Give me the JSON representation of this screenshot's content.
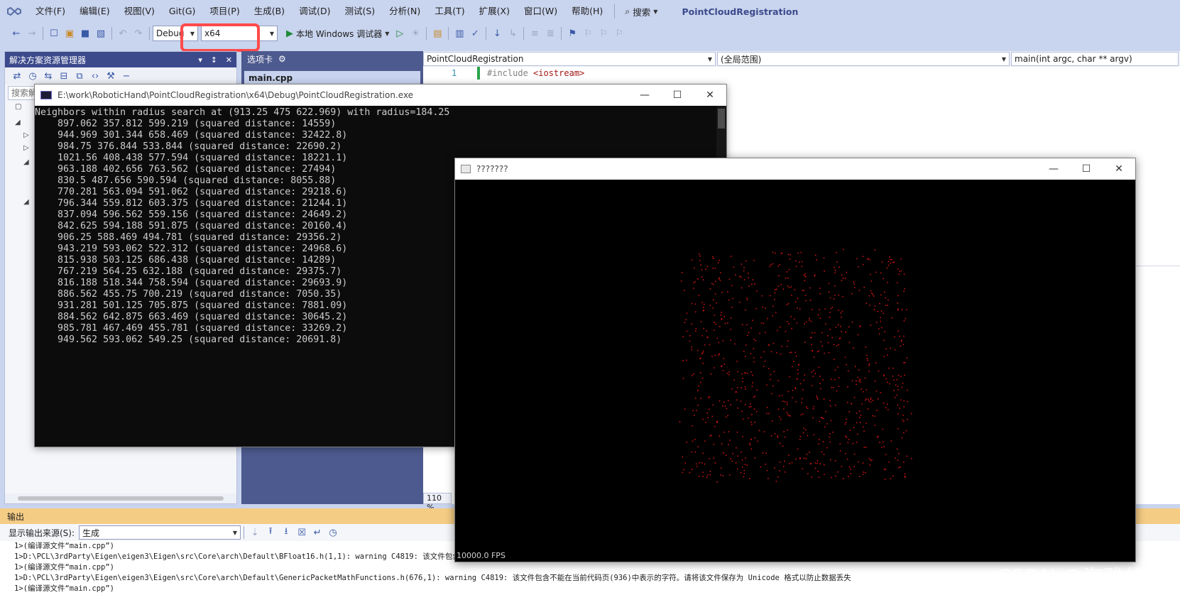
{
  "menubar": {
    "items": [
      "文件(F)",
      "编辑(E)",
      "视图(V)",
      "Git(G)",
      "项目(P)",
      "生成(B)",
      "调试(D)",
      "测试(S)",
      "分析(N)",
      "工具(T)",
      "扩展(X)",
      "窗口(W)",
      "帮助(H)"
    ],
    "search_label": "搜索",
    "solution_title": "PointCloudRegistration"
  },
  "toolbar": {
    "config": "Debug",
    "platform": "x64",
    "run_label": "本地 Windows 调试器"
  },
  "solution_explorer": {
    "title": "解决方案资源管理器",
    "search_placeholder": "搜索解"
  },
  "editor": {
    "tabwell_title": "选项卡",
    "active_tab": "main.cpp",
    "nav": {
      "project": "PointCloudRegistration",
      "scope": "(全局范围)",
      "member": "main(int argc, char ** argv)"
    },
    "line_number": "1",
    "code_prefix": "#include ",
    "code_include": "<iostream>",
    "zoom": "110 %"
  },
  "console": {
    "title": "E:\\work\\RoboticHand\\PointCloudRegistration\\x64\\Debug\\PointCloudRegistration.exe",
    "lines": [
      "Neighbors within radius search at (913.25 475 622.969) with radius=184.25",
      "    897.062 357.812 599.219 (squared distance: 14559)",
      "    944.969 301.344 658.469 (squared distance: 32422.8)",
      "    984.75 376.844 533.844 (squared distance: 22690.2)",
      "    1021.56 408.438 577.594 (squared distance: 18221.1)",
      "    963.188 402.656 763.562 (squared distance: 27494)",
      "    830.5 487.656 590.594 (squared distance: 8055.88)",
      "    770.281 563.094 591.062 (squared distance: 29218.6)",
      "    796.344 559.812 603.375 (squared distance: 21244.1)",
      "    837.094 596.562 559.156 (squared distance: 24649.2)",
      "    842.625 594.188 591.875 (squared distance: 20160.4)",
      "    906.25 588.469 494.781 (squared distance: 29356.2)",
      "    943.219 593.062 522.312 (squared distance: 24968.6)",
      "    815.938 503.125 686.438 (squared distance: 14289)",
      "    767.219 564.25 632.188 (squared distance: 29375.7)",
      "    816.188 518.344 758.594 (squared distance: 29693.9)",
      "    886.562 455.75 700.219 (squared distance: 7050.35)",
      "    931.281 501.125 705.875 (squared distance: 7881.09)",
      "    884.562 642.875 663.469 (squared distance: 30645.2)",
      "    985.781 467.469 455.781 (squared distance: 33269.2)",
      "    949.562 593.062 549.25 (squared distance: 20691.8)"
    ]
  },
  "viewer": {
    "title": "???????",
    "fps": "10000.0 FPS",
    "point_color": "#c81414",
    "point_count": 900
  },
  "output": {
    "title": "输出",
    "source_label": "显示输出来源(S):",
    "source_value": "生成",
    "lines": [
      "1>(编译源文件“main.cpp”)",
      "1>D:\\PCL\\3rdParty\\Eigen\\eigen3\\Eigen\\src\\Core\\arch\\Default\\BFloat16.h(1,1): warning C4819: 该文件包含不能",
      "1>(编译源文件“main.cpp”)",
      "1>D:\\PCL\\3rdParty\\Eigen\\eigen3\\Eigen\\src\\Core\\arch\\Default\\GenericPacketMathFunctions.h(676,1): warning C4819: 该文件包含不能在当前代码页(936)中表示的字符。请将该文件保存为 Unicode 格式以防止数据丢失",
      "1>(编译源文件“main.cpp”)"
    ]
  },
  "watermark": "CSDN @海雅信子",
  "colors": {
    "accent": "#3c4a8c",
    "highlight": "#ff4a4a",
    "output_header": "#f5cc84"
  }
}
